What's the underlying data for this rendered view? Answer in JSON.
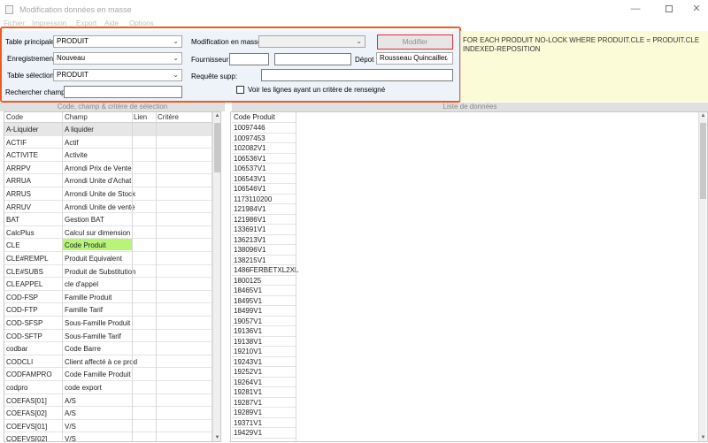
{
  "window": {
    "title": "Modification données en masse",
    "controls": {
      "minimize": "—",
      "close": "✕"
    }
  },
  "menu": [
    "Fichier",
    "Impression",
    "Export",
    "Aide",
    "Options"
  ],
  "form": {
    "table_principale_label": "Table principale:",
    "table_principale_value": "PRODUIT",
    "enregistrement_label": "Enregistrement:",
    "enregistrement_value": "Nouveau",
    "table_selection_label": "Table sélection:",
    "table_selection_value": "PRODUIT",
    "rechercher_label": "Rechercher champ:",
    "rechercher_value": "",
    "modification_label": "Modification en masse:",
    "modification_value": "",
    "modifier_button": "Modifier",
    "fournisseur_label": "Fournisseur:",
    "fournisseur_code": "",
    "fournisseur_name": "",
    "depot_label": "Dépot",
    "depot_value": "Rousseau Quincailler",
    "requete_label": "Requête supp:",
    "requete_value": "",
    "checkbox_label": "Voir les lignes ayant un critère de renseigné"
  },
  "query_text": [
    "FOR EACH PRODUIT NO-LOCK WHERE PRODUIT.CLE = PRODUIT.CLE",
    "INDEXED-REPOSITION"
  ],
  "left_section_title": "Code, champ & critère de sélection",
  "right_section_title": "Liste de données",
  "left_grid": {
    "columns": [
      "Code",
      "Champ",
      "Lien",
      "Critère"
    ],
    "rows": [
      [
        "A-Liquider",
        "A liquider"
      ],
      [
        "ACTIF",
        "Actif"
      ],
      [
        "ACTIVITE",
        "Activite"
      ],
      [
        "ARRPV",
        "Arrondi Prix de Vente"
      ],
      [
        "ARRUA",
        "Arrondi Unite d'Achat"
      ],
      [
        "ARRUS",
        "Arrondi Unite de Stock"
      ],
      [
        "ARRUV",
        "Arrondi Unite de vente"
      ],
      [
        "BAT",
        "Gestion BAT"
      ],
      [
        "CalcPlus",
        "Calcul sur dimension"
      ],
      [
        "CLE",
        "Code Produit"
      ],
      [
        "CLE#REMPL",
        "Produit Equivalent"
      ],
      [
        "CLE#SUBS",
        "Produit de Substitution"
      ],
      [
        "CLEAPPEL",
        "cle d'appel"
      ],
      [
        "COD-FSP",
        "Famille Produit"
      ],
      [
        "COD-FTP",
        "Famille Tarif"
      ],
      [
        "COD-SFSP",
        "Sous-Famille Produit"
      ],
      [
        "COD-SFTP",
        "Sous-Famille Tarif"
      ],
      [
        "codbar",
        "Code Barre"
      ],
      [
        "CODCLI",
        "Client affecté à ce prod"
      ],
      [
        "CODFAMPRO",
        "Code Famille Produit"
      ],
      [
        "codpro",
        "code export"
      ],
      [
        "COEFAS[01]",
        "A/S"
      ],
      [
        "COEFAS[02]",
        "A/S"
      ],
      [
        "COEFVS[01]",
        "V/S"
      ],
      [
        "COEFVS[02]",
        "V/S"
      ]
    ]
  },
  "right_grid": {
    "column": "Code Produit",
    "rows": [
      "10097446",
      "10097453",
      "102082V1",
      "106536V1",
      "106537V1",
      "106543V1",
      "106546V1",
      "1173110200",
      "121984V1",
      "121986V1",
      "133691V1",
      "136213V1",
      "138096V1",
      "138215V1",
      "1486FERBETXL2XL",
      "1800125",
      "18465V1",
      "18495V1",
      "18499V1",
      "19057V1",
      "19136V1",
      "19138V1",
      "19210V1",
      "19243V1",
      "19252V1",
      "19264V1",
      "19281V1",
      "19287V1",
      "19289V1",
      "19371V1",
      "19429V1"
    ]
  }
}
